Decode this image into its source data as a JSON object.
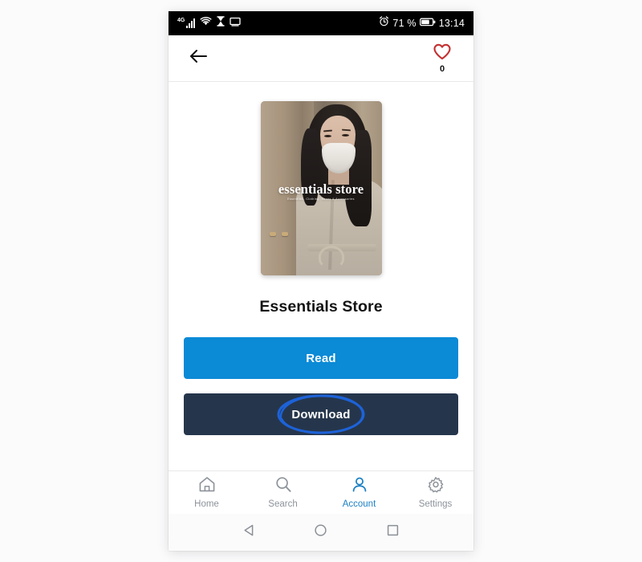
{
  "status_bar": {
    "network_type": "4G",
    "signal_icon": "signal-bars-icon",
    "wifi_icon": "wifi-icon",
    "hourglass_icon": "hourglass-icon",
    "cast_icon": "monitor-icon",
    "alarm_icon": "alarm-clock-icon",
    "battery_percent": "71 %",
    "battery_icon": "battery-icon",
    "time": "13:14"
  },
  "app_bar": {
    "back_icon": "arrow-left-icon",
    "favorite_icon": "heart-outline-icon",
    "favorite_color": "#c2302f",
    "favorite_count": "0"
  },
  "cover": {
    "title": "essentials store",
    "subtitle": "Essentials, Clothing, Shoes & Accessories",
    "alt": "book-cover-image"
  },
  "main": {
    "title": "Essentials Store",
    "read_label": "Read",
    "read_color": "#0b8ad6",
    "download_label": "Download",
    "download_color": "#25364c",
    "highlight_color": "#1d62d8"
  },
  "tabs": [
    {
      "label": "Home",
      "icon": "home-icon",
      "active": false
    },
    {
      "label": "Search",
      "icon": "search-icon",
      "active": false
    },
    {
      "label": "Account",
      "icon": "person-icon",
      "active": true
    },
    {
      "label": "Settings",
      "icon": "gear-icon",
      "active": false
    }
  ],
  "nav_bar": {
    "back": "triangle-back-icon",
    "home": "circle-home-icon",
    "recents": "square-recents-icon"
  }
}
